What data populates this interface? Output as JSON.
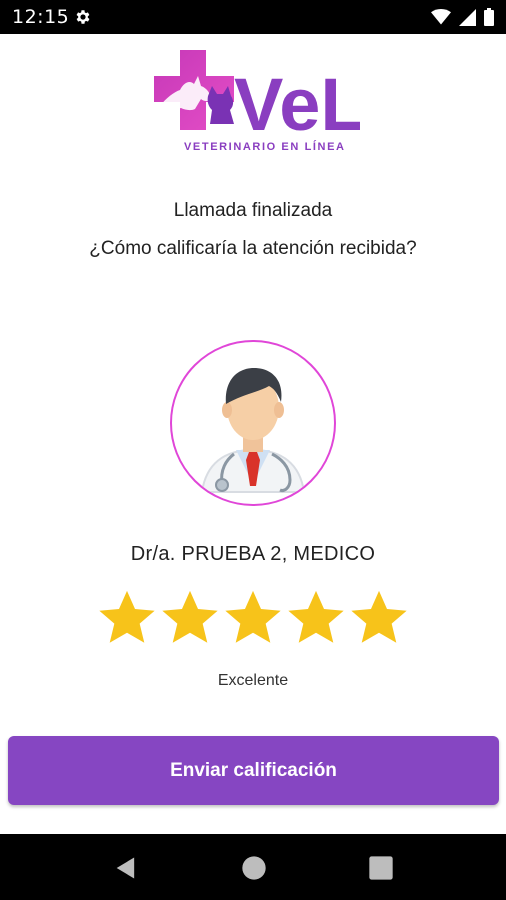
{
  "status_bar": {
    "time": "12:15",
    "icons": [
      "gear-icon",
      "wifi-icon",
      "signal-icon",
      "battery-icon"
    ]
  },
  "brand": {
    "name": "VeL",
    "tagline": "VETERINARIO EN LÍNEA",
    "colors": {
      "magenta": "#d43fb8",
      "purple": "#8a3ec0"
    }
  },
  "main": {
    "message_title": "Llamada finalizada",
    "message_question": "¿Cómo calificaría la atención recibida?",
    "doctor_name": "Dr/a. PRUEBA 2, MEDICO",
    "rating": {
      "value": 5,
      "max": 5,
      "label": "Excelente"
    },
    "submit_label": "Enviar calificación"
  },
  "colors": {
    "accent": "#8646c2",
    "star": "#f7c31a",
    "avatar_ring": "#e046d8"
  },
  "navbar": {
    "icons": [
      "back-icon",
      "home-icon",
      "recents-icon"
    ]
  }
}
